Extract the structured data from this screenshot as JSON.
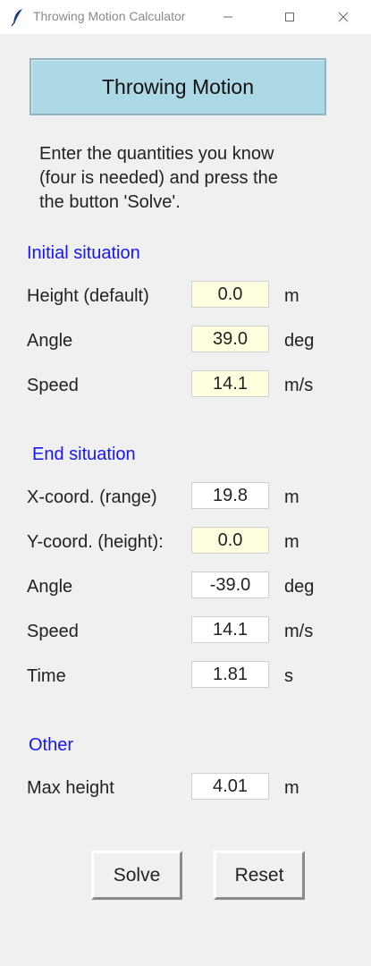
{
  "window": {
    "title": "Throwing Motion Calculator",
    "icons": [
      "feather-icon",
      "minimize-icon",
      "maximize-icon",
      "close-icon"
    ]
  },
  "header": {
    "title": "Throwing Motion"
  },
  "instructions": "Enter the quantities you know\n(four is needed) and press the\nthe button 'Solve'.",
  "colors": {
    "header_bg": "#add8e6",
    "section_text": "#1515ff",
    "known_field": "#ffffe0",
    "computed_field": "#ffffff"
  },
  "initial": {
    "heading": "Initial situation",
    "height": {
      "label": "Height (default)",
      "value": "0.0",
      "unit": "m"
    },
    "angle": {
      "label": "Angle",
      "value": "39.0",
      "unit": "deg"
    },
    "speed": {
      "label": "Speed",
      "value": "14.1",
      "unit": "m/s"
    }
  },
  "end": {
    "heading": "End situation",
    "x": {
      "label": "X-coord. (range)",
      "value": "19.8",
      "unit": "m"
    },
    "y": {
      "label": "Y-coord. (height):",
      "value": "0.0",
      "unit": "m"
    },
    "angle": {
      "label": "Angle",
      "value": "-39.0",
      "unit": "deg"
    },
    "speed": {
      "label": "Speed",
      "value": "14.1",
      "unit": "m/s"
    },
    "time": {
      "label": "Time",
      "value": "1.81",
      "unit": "s"
    }
  },
  "other": {
    "heading": "Other",
    "max_height": {
      "label": "Max height",
      "value": "4.01",
      "unit": "m"
    }
  },
  "buttons": {
    "solve": "Solve",
    "reset": "Reset"
  }
}
